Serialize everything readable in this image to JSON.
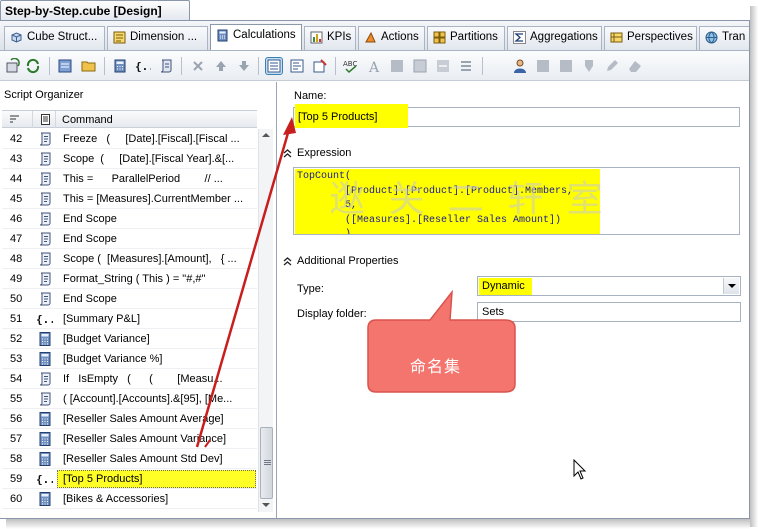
{
  "window": {
    "title": "Step-by-Step.cube [Design]"
  },
  "tabs": [
    {
      "label": "Cube Struct...",
      "icon": "cube-icon",
      "active": false
    },
    {
      "label": "Dimension ...",
      "icon": "dimension-usage-icon",
      "active": false
    },
    {
      "label": "Calculations",
      "icon": "calculator-icon",
      "active": true
    },
    {
      "label": "KPIs",
      "icon": "kpi-icon",
      "active": false
    },
    {
      "label": "Actions",
      "icon": "actions-icon",
      "active": false
    },
    {
      "label": "Partitions",
      "icon": "partitions-icon",
      "active": false
    },
    {
      "label": "Aggregations",
      "icon": "sigma-icon",
      "active": false
    },
    {
      "label": "Perspectives",
      "icon": "perspectives-icon",
      "active": false
    },
    {
      "label": "Tran",
      "icon": "globe-icon",
      "active": false
    }
  ],
  "script_organizer": {
    "title": "Script Organizer",
    "column_header": "Command",
    "rows": [
      {
        "num": "42",
        "icon": "script-icon",
        "command": "Freeze   (     [Date].[Fiscal].[Fiscal ..."
      },
      {
        "num": "43",
        "icon": "script-icon",
        "command": "Scope  (     [Date].[Fiscal Year].&[..."
      },
      {
        "num": "44",
        "icon": "script-icon",
        "command": "This =      ParallelPeriod        // ..."
      },
      {
        "num": "45",
        "icon": "script-icon",
        "command": "This = [Measures].CurrentMember ..."
      },
      {
        "num": "46",
        "icon": "script-icon",
        "command": "End Scope"
      },
      {
        "num": "47",
        "icon": "script-icon",
        "command": "End Scope"
      },
      {
        "num": "48",
        "icon": "script-icon",
        "command": "Scope (  [Measures].[Amount],   { ..."
      },
      {
        "num": "49",
        "icon": "script-icon",
        "command": "Format_String ( This ) = \"#,#\""
      },
      {
        "num": "50",
        "icon": "script-icon",
        "command": "End Scope"
      },
      {
        "num": "51",
        "icon": "named-set-icon",
        "command": "[Summary P&L]"
      },
      {
        "num": "52",
        "icon": "calculated-member-icon",
        "command": "[Budget Variance]"
      },
      {
        "num": "53",
        "icon": "calculated-member-icon",
        "command": "[Budget Variance %]"
      },
      {
        "num": "54",
        "icon": "script-icon",
        "command": "If   IsEmpty   (      (        [Measu..."
      },
      {
        "num": "55",
        "icon": "script-icon",
        "command": "( [Account].[Accounts].&[95], [Me..."
      },
      {
        "num": "56",
        "icon": "calculated-member-icon",
        "command": "[Reseller Sales Amount Average]"
      },
      {
        "num": "57",
        "icon": "calculated-member-icon",
        "command": "[Reseller Sales Amount Variance]"
      },
      {
        "num": "58",
        "icon": "calculated-member-icon",
        "command": "[Reseller Sales Amount Std Dev]"
      },
      {
        "num": "59",
        "icon": "named-set-icon",
        "command": "[Top 5 Products]",
        "selected": true
      },
      {
        "num": "60",
        "icon": "calculated-member-icon",
        "command": "[Bikes & Accessories]"
      }
    ]
  },
  "editor": {
    "name_label": "Name:",
    "name_value": "[Top 5 Products]",
    "expression_label": "Expression",
    "expression_lines": [
      "TopCount(",
      "        [Product].[Product].[Product].Members,",
      "        5,",
      "        ([Measures].[Reseller Sales Amount])",
      "        )"
    ],
    "additional_label": "Additional Properties",
    "type_label": "Type:",
    "type_value": "Dynamic",
    "folder_label": "Display folder:",
    "folder_value": "Sets"
  },
  "annotation": {
    "callout_text": "命名集",
    "watermark": "逖 关 二 轩 室",
    "callout_color": "#f4756e",
    "arrow_color": "#c81e1e",
    "highlight_color": "#ffff00"
  }
}
